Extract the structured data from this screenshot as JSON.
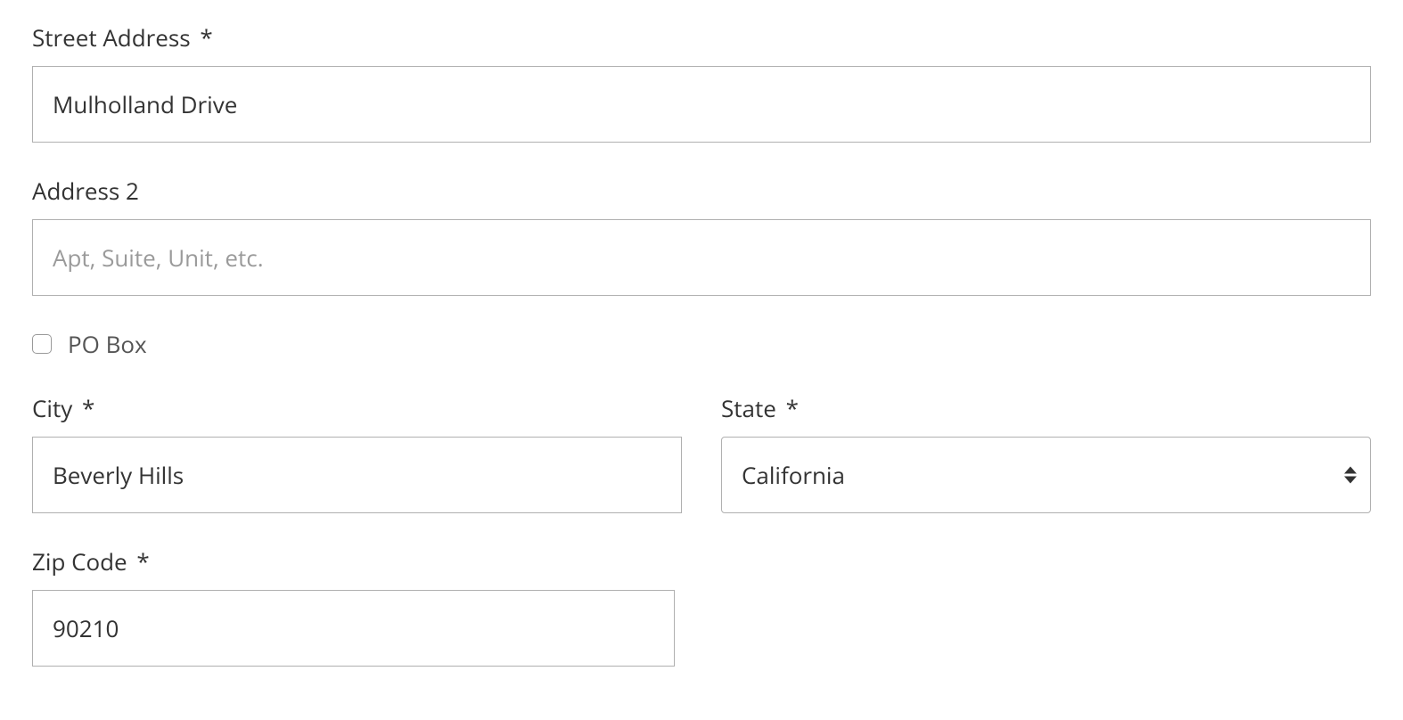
{
  "form": {
    "street": {
      "label": "Street Address",
      "required_mark": "*",
      "value": "Mulholland Drive"
    },
    "address2": {
      "label": "Address 2",
      "placeholder": "Apt, Suite, Unit, etc.",
      "value": ""
    },
    "pobox": {
      "label": "PO Box",
      "checked": false
    },
    "city": {
      "label": "City",
      "required_mark": "*",
      "value": "Beverly Hills"
    },
    "state": {
      "label": "State",
      "required_mark": "*",
      "value": "California"
    },
    "zip": {
      "label": "Zip Code",
      "required_mark": "*",
      "value": "90210"
    }
  }
}
